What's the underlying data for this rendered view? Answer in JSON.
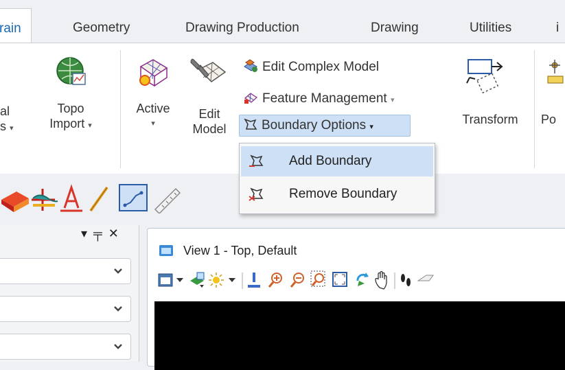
{
  "tabs": {
    "terrain": "rain",
    "geometry": "Geometry",
    "drawing_production": "Drawing Production",
    "drawing": "Drawing",
    "utilities": "Utilities",
    "overflow": "i"
  },
  "ribbon": {
    "partial_left_top": "al",
    "partial_left_bottom": "s",
    "topo_top": "Topo",
    "topo_bottom": "Import",
    "active": "Active",
    "edit_top": "Edit",
    "edit_bottom": "Model",
    "edit_complex_model": "Edit Complex Model",
    "feature_management": "Feature Management",
    "boundary_options": "Boundary Options",
    "transform": "Transform",
    "partial_right": "Po",
    "caret": "▾"
  },
  "boundary_menu": {
    "add_boundary": "Add Boundary",
    "remove_boundary": "Remove Boundary"
  },
  "panel": {
    "pin_glyph": "▾ ╤ ✕"
  },
  "view": {
    "title": "View 1 - Top, Default"
  },
  "colors": {
    "accent_blue": "#1a66b5",
    "selection_bg": "#cde0f5",
    "view_background": "#000000"
  }
}
